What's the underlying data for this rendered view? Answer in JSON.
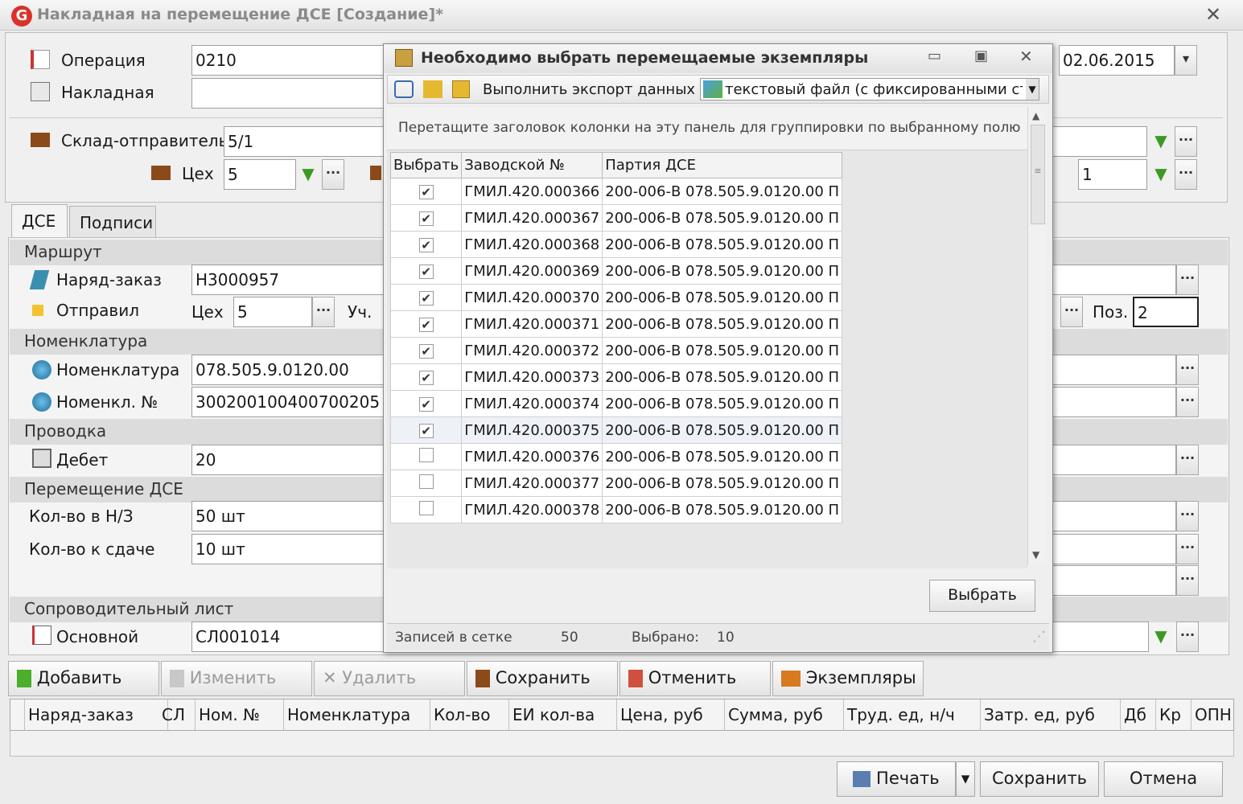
{
  "window": {
    "title": "Накладная на перемещение ДСЕ [Создание]*",
    "logo": "G"
  },
  "header": {
    "operation_label": "Операция",
    "operation_value": "0210",
    "invoice_label": "Накладная",
    "invoice_value": "",
    "date_value": "02.06.2015",
    "sender_label": "Склад-отправитель",
    "sender_value": "5/1",
    "shop_label": "Цех",
    "shop_value": "5",
    "right_value": "1"
  },
  "tabs": [
    {
      "label": "ДСЕ"
    },
    {
      "label": "Подписи"
    }
  ],
  "sections": {
    "route": "Маршрут",
    "nomenclature": "Номенклатура",
    "posting": "Проводка",
    "movement": "Перемещение ДСЕ",
    "cover": "Сопроводительный лист"
  },
  "fields": {
    "order_label": "Наряд-заказ",
    "order_value": "Н3000957",
    "sent_label": "Отправил",
    "sent_shop_label": "Цех",
    "sent_shop_value": "5",
    "sent_section_label": "Уч.",
    "pos_label": "Поз.",
    "pos_value": "2",
    "nom_label": "Номенклатура",
    "nom_value": "078.505.9.0120.00",
    "nom_no_label": "Номенкл. №",
    "nom_no_value": "300200100400700205",
    "debit_label": "Дебет",
    "debit_value": "20",
    "qty_order_label": "Кол-во в Н/З",
    "qty_order_value": "50 шт",
    "qty_deliver_label": "Кол-во к сдаче",
    "qty_deliver_value": "10 шт",
    "main_label": "Основной",
    "main_value": "СЛ001014"
  },
  "toolbar": {
    "add": "Добавить",
    "edit": "Изменить",
    "delete": "Удалить",
    "save": "Сохранить",
    "cancel": "Отменить",
    "instances": "Экземпляры"
  },
  "grid_columns": [
    "Наряд-заказ",
    "СЛ",
    "Ном. №",
    "Номенклатура",
    "Кол-во",
    "ЕИ кол-ва",
    "Цена, руб",
    "Сумма, руб",
    "Труд. ед, н/ч",
    "Затр. ед, руб",
    "Дб",
    "Кр",
    "ОПН"
  ],
  "bottom": {
    "print": "Печать",
    "save": "Сохранить",
    "cancel": "Отмена"
  },
  "dialog": {
    "title": "Необходимо выбрать перемещаемые экземпляры",
    "export_label": "Выполнить экспорт данных в:",
    "export_value": "текстовый файл (с фиксированными столбц",
    "group_hint": "Перетащите заголовок колонки на эту панель для группировки по выбранному полю",
    "columns": {
      "select": "Выбрать",
      "serial": "Заводской №",
      "batch": "Партия ДСЕ"
    },
    "rows": [
      {
        "checked": true,
        "serial": "ГМИЛ.420.000366",
        "batch": "200-006-В 078.505.9.0120.00 П"
      },
      {
        "checked": true,
        "serial": "ГМИЛ.420.000367",
        "batch": "200-006-В 078.505.9.0120.00 П"
      },
      {
        "checked": true,
        "serial": "ГМИЛ.420.000368",
        "batch": "200-006-В 078.505.9.0120.00 П"
      },
      {
        "checked": true,
        "serial": "ГМИЛ.420.000369",
        "batch": "200-006-В 078.505.9.0120.00 П"
      },
      {
        "checked": true,
        "serial": "ГМИЛ.420.000370",
        "batch": "200-006-В 078.505.9.0120.00 П"
      },
      {
        "checked": true,
        "serial": "ГМИЛ.420.000371",
        "batch": "200-006-В 078.505.9.0120.00 П"
      },
      {
        "checked": true,
        "serial": "ГМИЛ.420.000372",
        "batch": "200-006-В 078.505.9.0120.00 П"
      },
      {
        "checked": true,
        "serial": "ГМИЛ.420.000373",
        "batch": "200-006-В 078.505.9.0120.00 П"
      },
      {
        "checked": true,
        "serial": "ГМИЛ.420.000374",
        "batch": "200-006-В 078.505.9.0120.00 П"
      },
      {
        "checked": true,
        "serial": "ГМИЛ.420.000375",
        "batch": "200-006-В 078.505.9.0120.00 П"
      },
      {
        "checked": false,
        "serial": "ГМИЛ.420.000376",
        "batch": "200-006-В 078.505.9.0120.00 П"
      },
      {
        "checked": false,
        "serial": "ГМИЛ.420.000377",
        "batch": "200-006-В 078.505.9.0120.00 П"
      },
      {
        "checked": false,
        "serial": "ГМИЛ.420.000378",
        "batch": "200-006-В 078.505.9.0120.00 П"
      }
    ],
    "select_button": "Выбрать",
    "status_records_label": "Записей в сетке",
    "status_records_value": "50",
    "status_selected_label": "Выбрано:",
    "status_selected_value": "10"
  }
}
